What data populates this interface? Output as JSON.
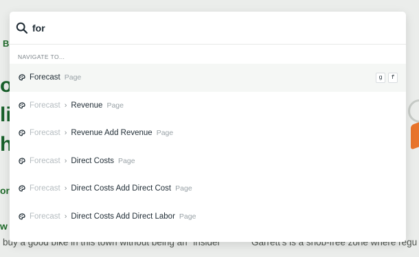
{
  "search": {
    "query": "for"
  },
  "section_label": "NAVIGATE TO...",
  "results": [
    {
      "crumb": "",
      "title": "Forecast",
      "kind": "Page",
      "shortcut": [
        "g",
        "f"
      ],
      "selected": true
    },
    {
      "crumb": "Forecast",
      "title": "Revenue",
      "kind": "Page"
    },
    {
      "crumb": "Forecast",
      "title": "Revenue Add Revenue",
      "kind": "Page"
    },
    {
      "crumb": "Forecast",
      "title": "Direct Costs",
      "kind": "Page"
    },
    {
      "crumb": "Forecast",
      "title": "Direct Costs Add Direct Cost",
      "kind": "Page"
    },
    {
      "crumb": "Forecast",
      "title": "Direct Costs Add Direct Labor",
      "kind": "Page"
    }
  ],
  "breadcrumb_separator": "›",
  "background": {
    "left_fragment_b": "B",
    "left_fragments": [
      "of",
      "lic",
      "h"
    ],
    "left_fragment_or": "or",
    "left_fragment_w": "w",
    "bottom_left": "buy a good bike in this town without being an \"insider\"",
    "bottom_right": "Garrett's is a snob-free zone where regu"
  },
  "colors": {
    "accent_green": "#1f6b2a",
    "text_dark": "#1d2a33",
    "muted": "#b5bcc0"
  },
  "icons": {
    "search": "search-icon",
    "row": "forecast-page-icon"
  }
}
